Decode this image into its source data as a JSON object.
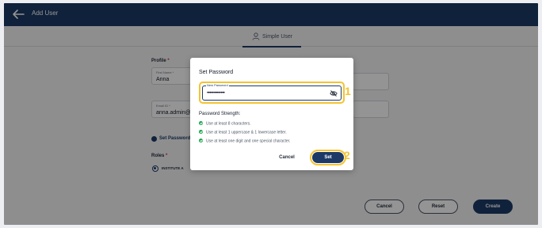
{
  "header": {
    "title": "Add User"
  },
  "tabs": [
    {
      "label": "Simple User"
    }
  ],
  "form": {
    "profile_label": "Profile",
    "required_mark": "*",
    "first_name": {
      "label": "First Name *",
      "value": "Anna"
    },
    "email": {
      "label": "Email ID *",
      "value": "anna.admin@i"
    },
    "set_password_label": "Set Password",
    "roles_label": "Roles",
    "role_option": "INSTITUTE A"
  },
  "footer": {
    "cancel": "Cancel",
    "reset": "Reset",
    "create": "Create"
  },
  "modal": {
    "title": "Set Password",
    "password_label": "New Password",
    "password_value": "••••••••••••••",
    "strength_title": "Password Strength:",
    "rules": [
      "Use at least 8 characters.",
      "Use at least 1 uppercase & 1 lowercase letter.",
      "Use at least one digit and one special character."
    ],
    "cancel": "Cancel",
    "set": "Set"
  },
  "annotations": {
    "step1": "1",
    "step2": "2"
  },
  "colors": {
    "primary": "#1d3a67",
    "highlight": "#f4c430",
    "success": "#16a34a",
    "required": "#d92d20"
  },
  "icons": [
    "back-arrow-icon",
    "user-icon",
    "eye-off-icon",
    "check-circle-icon"
  ]
}
